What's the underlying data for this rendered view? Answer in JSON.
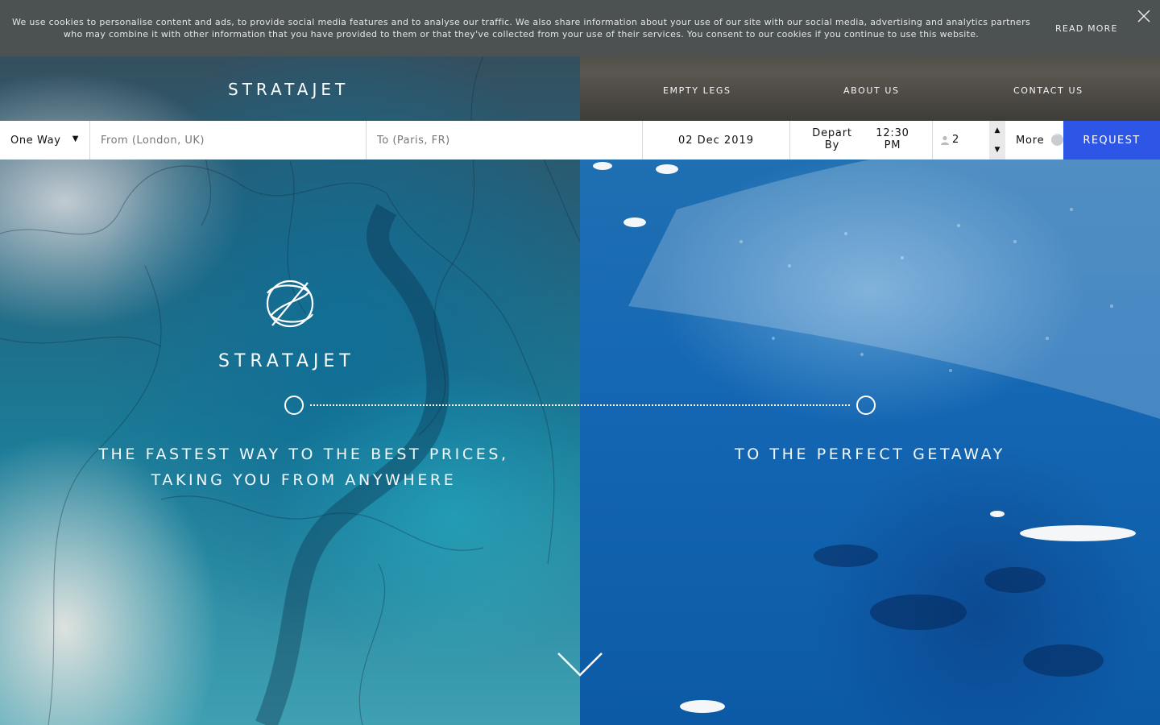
{
  "cookie_bar": {
    "text": "We use cookies to personalise content and ads, to provide social media features and to analyse our traffic. We also share information about your use of our site with our social media, advertising and analytics partners who may combine it with other information that you have provided to them or that they've collected from your use of their services. You consent to our cookies if you continue to use this website.",
    "read_more": "READ MORE",
    "close_icon": "close-icon"
  },
  "header": {
    "logo_text": "STRATAJET",
    "nav": [
      {
        "label": "EMPTY LEGS"
      },
      {
        "label": "ABOUT US"
      },
      {
        "label": "CONTACT US"
      }
    ]
  },
  "booking_bar": {
    "trip_type": "One Way",
    "trip_type_caret": "▼",
    "from_placeholder": "From (London, UK)",
    "to_placeholder": "To (Paris, FR)",
    "date": "02 Dec 2019",
    "depart_label": "Depart By",
    "depart_time": "12:30 PM",
    "passengers": "2",
    "step_up": "▲",
    "step_down": "▼",
    "more_label": "More",
    "request_label": "REQUEST",
    "accent_color": "#2e56e6"
  },
  "hero": {
    "logo_text": "STRATAJET",
    "tagline_left": "THE FASTEST WAY TO THE BEST PRICES, TAKING YOU FROM ANYWHERE",
    "tagline_right": "TO THE PERFECT GETAWAY",
    "scroll_icon": "chevron-down-icon"
  }
}
